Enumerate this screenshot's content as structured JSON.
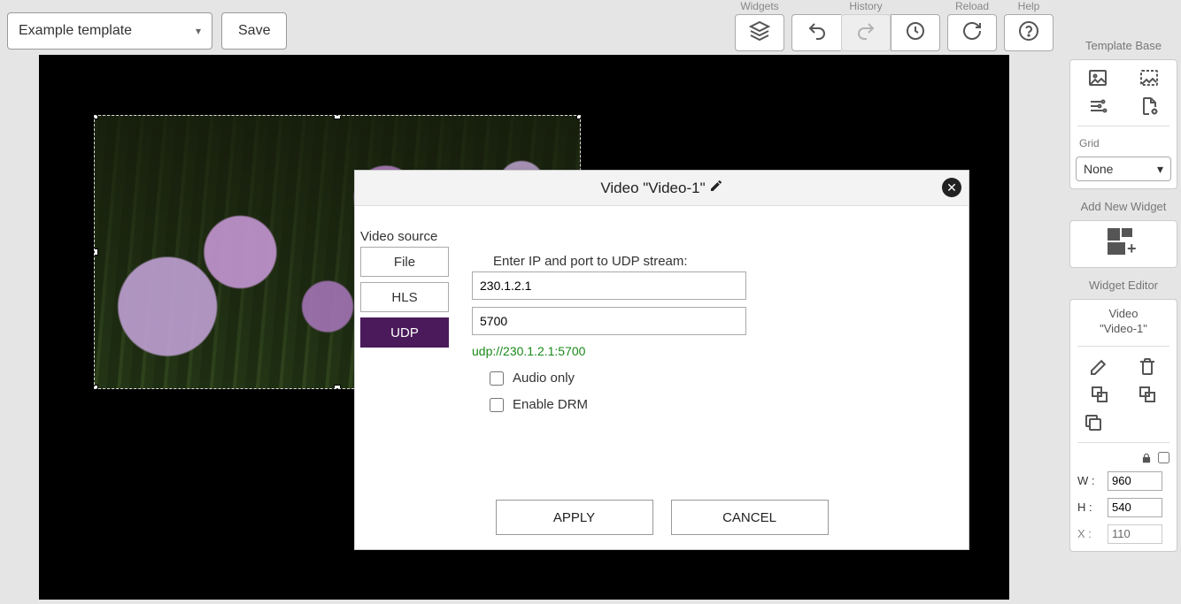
{
  "toolbar": {
    "template_name": "Example template",
    "save_label": "Save",
    "widgets_label": "Widgets",
    "history_label": "History",
    "reload_label": "Reload",
    "help_label": "Help"
  },
  "dialog": {
    "title": "Video \"Video-1\"",
    "source_label": "Video source",
    "tabs": {
      "file": "File",
      "hls": "HLS",
      "udp": "UDP"
    },
    "prompt": "Enter IP and port to UDP stream:",
    "ip_value": "230.1.2.1",
    "port_value": "5700",
    "url": "udp://230.1.2.1:5700",
    "audio_only_label": "Audio only",
    "enable_drm_label": "Enable DRM",
    "apply_label": "APPLY",
    "cancel_label": "CANCEL"
  },
  "sidebar": {
    "template_base_title": "Template Base",
    "grid_label": "Grid",
    "grid_value": "None",
    "add_widget_title": "Add New Widget",
    "widget_editor_title": "Widget Editor",
    "widget_name_line1": "Video",
    "widget_name_line2": "\"Video-1\"",
    "w_label": "W :",
    "h_label": "H :",
    "x_label": "X :",
    "w_value": "960",
    "h_value": "540",
    "x_value": "110"
  }
}
